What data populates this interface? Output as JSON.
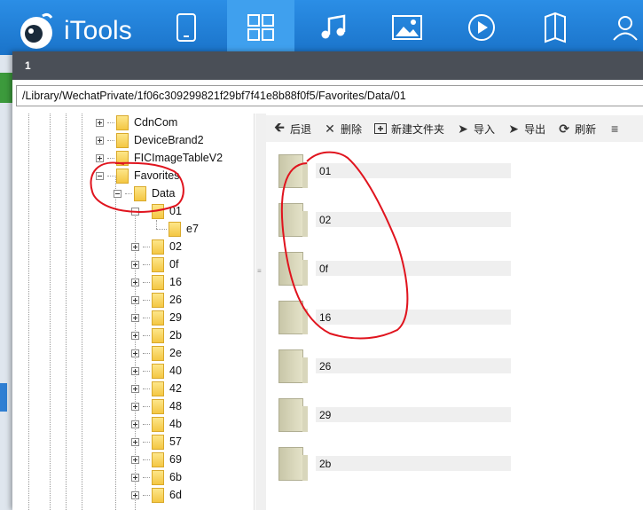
{
  "app": {
    "name": "iTools"
  },
  "nav": [
    {
      "id": "device",
      "icon": "phone-icon"
    },
    {
      "id": "apps",
      "icon": "apps-grid-icon",
      "active": true
    },
    {
      "id": "music",
      "icon": "music-icon"
    },
    {
      "id": "photos",
      "icon": "photo-icon"
    },
    {
      "id": "video",
      "icon": "play-icon"
    },
    {
      "id": "books",
      "icon": "book-icon"
    },
    {
      "id": "account",
      "icon": "user-icon"
    }
  ],
  "dialog": {
    "title": "1",
    "path": "/Library/WechatPrivate/1f06c309299821f29bf7f41e8b88f0f5/Favorites/Data/01"
  },
  "tree": {
    "upper": [
      {
        "label": "CdnCom"
      },
      {
        "label": "DeviceBrand2"
      },
      {
        "label": "FICImageTableV2"
      },
      {
        "label": "Favorites"
      }
    ],
    "data": {
      "label": "Data"
    },
    "data_01": {
      "label": "01"
    },
    "leaf": {
      "label": "e7"
    },
    "children": [
      {
        "label": "02"
      },
      {
        "label": "0f"
      },
      {
        "label": "16"
      },
      {
        "label": "26"
      },
      {
        "label": "29"
      },
      {
        "label": "2b"
      },
      {
        "label": "2e"
      },
      {
        "label": "40"
      },
      {
        "label": "42"
      },
      {
        "label": "48"
      },
      {
        "label": "4b"
      },
      {
        "label": "57"
      },
      {
        "label": "69"
      },
      {
        "label": "6b"
      },
      {
        "label": "6d"
      }
    ]
  },
  "toolbar": {
    "back": "后退",
    "delete": "删除",
    "new_folder": "新建文件夹",
    "import": "导入",
    "export": "导出",
    "refresh": "刷新"
  },
  "files": [
    {
      "name": "01"
    },
    {
      "name": "02"
    },
    {
      "name": "0f"
    },
    {
      "name": "16"
    },
    {
      "name": "26"
    },
    {
      "name": "29"
    },
    {
      "name": "2b"
    }
  ],
  "colors": {
    "appbar": "#1f7ad0",
    "annotation": "#e0141e",
    "titlebar": "#4a4f57"
  }
}
